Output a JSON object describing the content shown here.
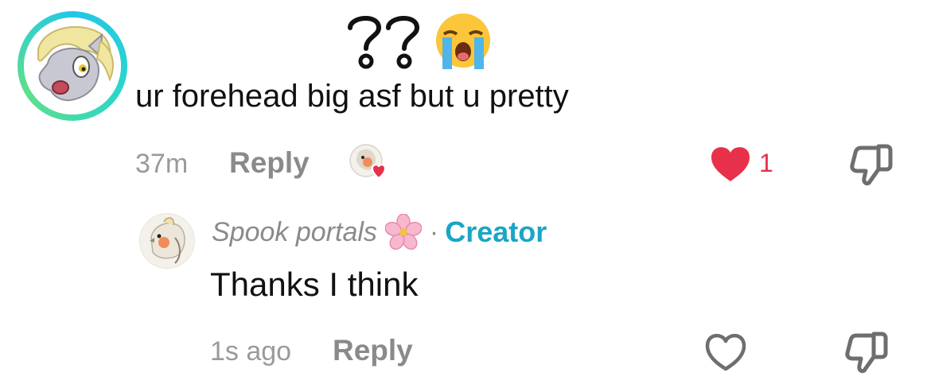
{
  "comment": {
    "text": "ur forehead big asf but u pretty",
    "time": "37m",
    "reply_label": "Reply",
    "like_count": "1",
    "liked": true
  },
  "reply": {
    "author": "Spook portals",
    "separator": "·",
    "creator_badge": "Creator",
    "text": "Thanks I think",
    "time": "1s ago",
    "reply_label": "Reply",
    "liked": false
  },
  "colors": {
    "like_red": "#e8304a",
    "creator_blue": "#1aa5c6",
    "muted_gray": "#8a8a8a",
    "avatar_ring": "#22c7e8"
  },
  "icons": {
    "question_marks": "double-question-mark-emoji",
    "crying": "loudly-crying-face-emoji",
    "flower": "cherry-blossom-emoji",
    "like": "heart-icon",
    "dislike": "thumbs-down-icon"
  }
}
